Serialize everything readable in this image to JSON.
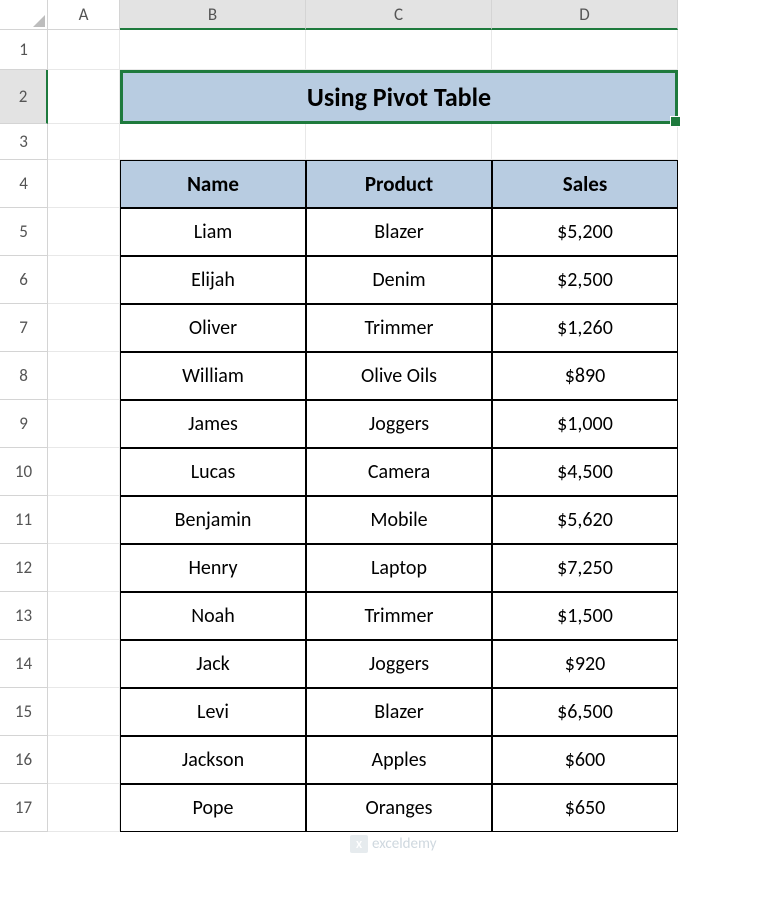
{
  "columns": [
    "A",
    "B",
    "C",
    "D"
  ],
  "rows": [
    "1",
    "2",
    "3",
    "4",
    "5",
    "6",
    "7",
    "8",
    "9",
    "10",
    "11",
    "12",
    "13",
    "14",
    "15",
    "16",
    "17"
  ],
  "title": "Using Pivot Table",
  "headers": {
    "c1": "Name",
    "c2": "Product",
    "c3": "Sales"
  },
  "data": [
    {
      "name": "Liam",
      "product": "Blazer",
      "sales": "$5,200"
    },
    {
      "name": "Elijah",
      "product": "Denim",
      "sales": "$2,500"
    },
    {
      "name": "Oliver",
      "product": "Trimmer",
      "sales": "$1,260"
    },
    {
      "name": "William",
      "product": "Olive Oils",
      "sales": "$890"
    },
    {
      "name": "James",
      "product": "Joggers",
      "sales": "$1,000"
    },
    {
      "name": "Lucas",
      "product": "Camera",
      "sales": "$4,500"
    },
    {
      "name": "Benjamin",
      "product": "Mobile",
      "sales": "$5,620"
    },
    {
      "name": "Henry",
      "product": "Laptop",
      "sales": "$7,250"
    },
    {
      "name": "Noah",
      "product": "Trimmer",
      "sales": "$1,500"
    },
    {
      "name": "Jack",
      "product": "Joggers",
      "sales": "$920"
    },
    {
      "name": "Levi",
      "product": "Blazer",
      "sales": "$6,500"
    },
    {
      "name": "Jackson",
      "product": "Apples",
      "sales": "$600"
    },
    {
      "name": "Pope",
      "product": "Oranges",
      "sales": "$650"
    }
  ],
  "watermark": "exceldemy"
}
